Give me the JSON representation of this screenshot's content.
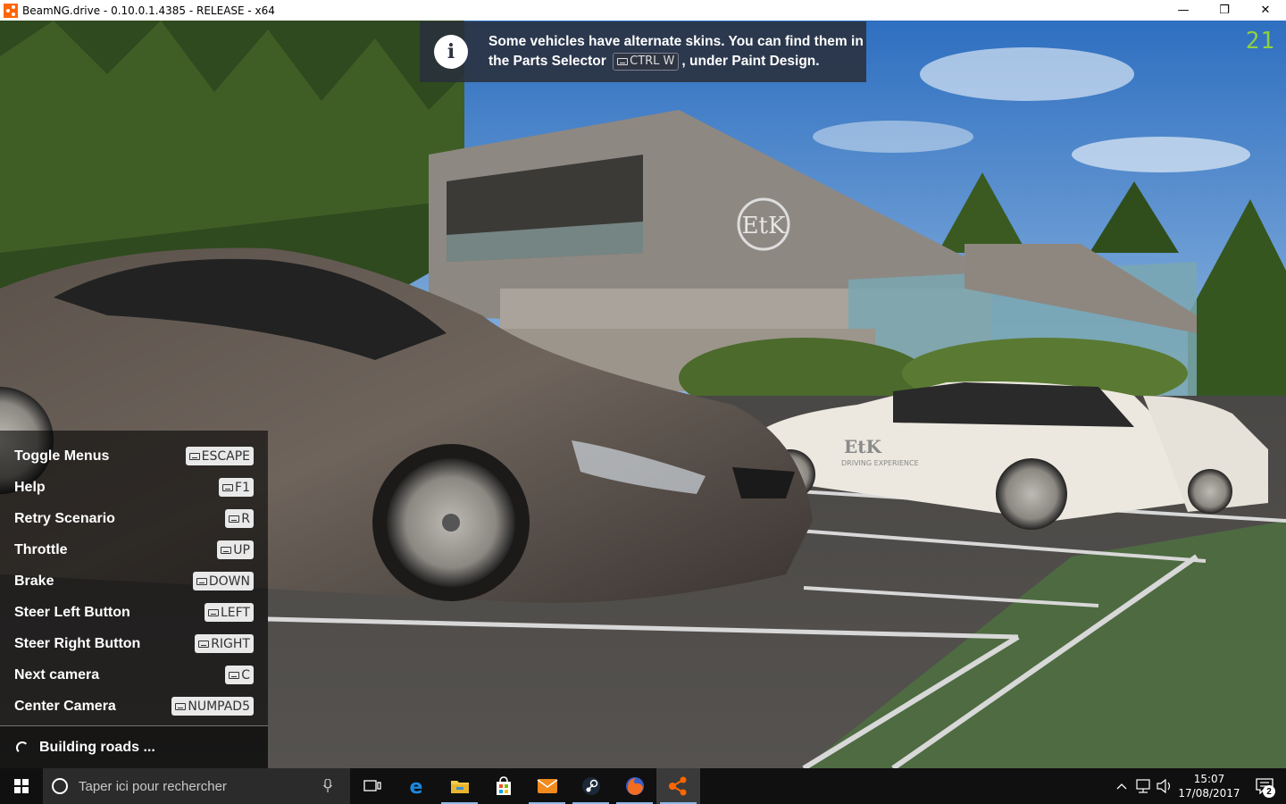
{
  "window": {
    "title": "BeamNG.drive - 0.10.0.1.4385 - RELEASE - x64",
    "minimize": "—",
    "maximize": "❐",
    "close": "✕"
  },
  "hud": {
    "fps": "21"
  },
  "toast": {
    "icon": "info-icon",
    "line1": "Some vehicles have alternate skins. You can find them in",
    "line2_before": "the Parts Selector",
    "key": "CTRL W",
    "line2_after": ", under Paint Design."
  },
  "help": {
    "items": [
      {
        "label": "Toggle Menus",
        "key": "ESCAPE"
      },
      {
        "label": "Help",
        "key": "F1"
      },
      {
        "label": "Retry Scenario",
        "key": "R"
      },
      {
        "label": "Throttle",
        "key": "UP"
      },
      {
        "label": "Brake",
        "key": "DOWN"
      },
      {
        "label": "Steer Left Button",
        "key": "LEFT"
      },
      {
        "label": "Steer Right Button",
        "key": "RIGHT"
      },
      {
        "label": "Next camera",
        "key": "C"
      },
      {
        "label": "Center Camera",
        "key": "NUMPAD5"
      }
    ],
    "loading": "Building roads ..."
  },
  "scene": {
    "building_logo": "EtK",
    "livery_logo": "EtK",
    "livery_text": "DRIVING EXPERIENCE"
  },
  "taskbar": {
    "search_placeholder": "Taper ici pour rechercher",
    "apps": [
      "task-view-icon",
      "edge-icon",
      "file-explorer-icon",
      "store-icon",
      "mail-icon",
      "steam-icon",
      "firefox-icon",
      "beamng-icon"
    ],
    "time": "15:07",
    "date": "17/08/2017",
    "notifications": "2"
  },
  "colors": {
    "fps": "#8fd13f",
    "toast_bg": "#2a303c",
    "taskbar": "#101010",
    "sky": "#3f7fc9"
  }
}
